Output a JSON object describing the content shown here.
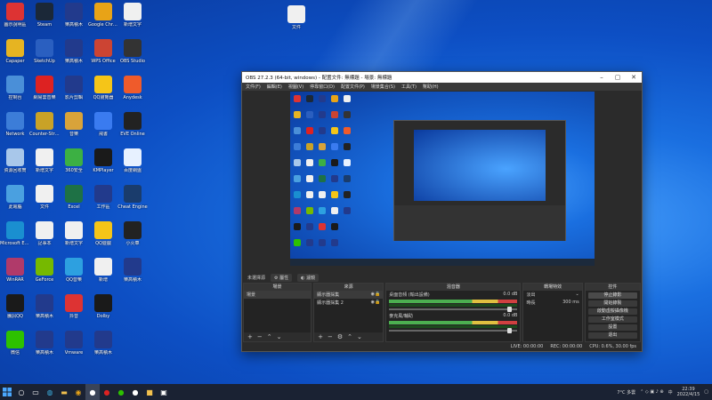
{
  "desktop_icons": [
    {
      "label": "圖示說明區",
      "col": 0,
      "row": 0,
      "color": "#d33"
    },
    {
      "label": "Steam",
      "col": 1,
      "row": 0,
      "color": "#1b2838"
    },
    {
      "label": "樂高積木",
      "col": 2,
      "row": 0,
      "color": "#223a8c"
    },
    {
      "label": "Google Chrome",
      "col": 3,
      "row": 0,
      "color": "#e8a317"
    },
    {
      "label": "新增文字",
      "col": 4,
      "row": 0,
      "color": "#f0f0f0"
    },
    {
      "label": "Capaper",
      "col": 0,
      "row": 1,
      "color": "#e6b422"
    },
    {
      "label": "SketchUp",
      "col": 1,
      "row": 1,
      "color": "#2a5fc0"
    },
    {
      "label": "樂高積木",
      "col": 2,
      "row": 1,
      "color": "#223a8c"
    },
    {
      "label": "WPS Office",
      "col": 3,
      "row": 1,
      "color": "#c43"
    },
    {
      "label": "OBS Studio",
      "col": 4,
      "row": 1,
      "color": "#333"
    },
    {
      "label": "控制台",
      "col": 0,
      "row": 2,
      "color": "#4a8fd8"
    },
    {
      "label": "網易雲音樂",
      "col": 1,
      "row": 2,
      "color": "#d22"
    },
    {
      "label": "影片剪輯",
      "col": 2,
      "row": 2,
      "color": "#223a8c"
    },
    {
      "label": "QQ瀏覽器",
      "col": 3,
      "row": 2,
      "color": "#f5c518"
    },
    {
      "label": "Anydesk",
      "col": 4,
      "row": 2,
      "color": "#ef5b2b"
    },
    {
      "label": "Network",
      "col": 0,
      "row": 3,
      "color": "#3c7dd8"
    },
    {
      "label": "Counter-Strike",
      "col": 1,
      "row": 3,
      "color": "#c9a227"
    },
    {
      "label": "音樂",
      "col": 2,
      "row": 3,
      "color": "#d8a33a"
    },
    {
      "label": "飛書",
      "col": 3,
      "row": 3,
      "color": "#3a7bf0"
    },
    {
      "label": "EVE Online",
      "col": 4,
      "row": 3,
      "color": "#222"
    },
    {
      "label": "资源回收筒",
      "col": 0,
      "row": 4,
      "color": "#a8c7ea"
    },
    {
      "label": "新增文字",
      "col": 1,
      "row": 4,
      "color": "#f0f0f0"
    },
    {
      "label": "360安全",
      "col": 2,
      "row": 4,
      "color": "#3cb043"
    },
    {
      "label": "KMPlayer",
      "col": 3,
      "row": 4,
      "color": "#1a1a1a"
    },
    {
      "label": "百度網盤",
      "col": 4,
      "row": 4,
      "color": "#e7f1ff"
    },
    {
      "label": "此電腦",
      "col": 0,
      "row": 5,
      "color": "#4aa0e0"
    },
    {
      "label": "文件",
      "col": 1,
      "row": 5,
      "color": "#f0f0f0"
    },
    {
      "label": "Excel",
      "col": 2,
      "row": 5,
      "color": "#1e7145"
    },
    {
      "label": "工作區",
      "col": 3,
      "row": 5,
      "color": "#223a8c"
    },
    {
      "label": "Cheat Engine",
      "col": 4,
      "row": 5,
      "color": "#1a3c6c"
    },
    {
      "label": "Microsoft Edge",
      "col": 0,
      "row": 6,
      "color": "#1a8fd0"
    },
    {
      "label": "記事本",
      "col": 1,
      "row": 6,
      "color": "#f0f0f0"
    },
    {
      "label": "新增文字",
      "col": 2,
      "row": 6,
      "color": "#f0f0f0"
    },
    {
      "label": "QQ遊戲",
      "col": 3,
      "row": 6,
      "color": "#f5c518"
    },
    {
      "label": "小火車",
      "col": 4,
      "row": 6,
      "color": "#222"
    },
    {
      "label": "WinRAR",
      "col": 0,
      "row": 7,
      "color": "#b03a6a"
    },
    {
      "label": "GeForce",
      "col": 1,
      "row": 7,
      "color": "#76b900"
    },
    {
      "label": "QQ音樂",
      "col": 2,
      "row": 7,
      "color": "#2da0e0"
    },
    {
      "label": "新增",
      "col": 3,
      "row": 7,
      "color": "#f0f0f0"
    },
    {
      "label": "樂高積木",
      "col": 4,
      "row": 7,
      "color": "#223a8c"
    },
    {
      "label": "騰訊QQ",
      "col": 0,
      "row": 8,
      "color": "#1a1a1a"
    },
    {
      "label": "樂高積木",
      "col": 1,
      "row": 8,
      "color": "#223a8c"
    },
    {
      "label": "抖音",
      "col": 2,
      "row": 8,
      "color": "#d33"
    },
    {
      "label": "Dolby",
      "col": 3,
      "row": 8,
      "color": "#1a1a1a"
    },
    {
      "label": "微信",
      "col": 0,
      "row": 9,
      "color": "#2dc100"
    },
    {
      "label": "樂高積木",
      "col": 1,
      "row": 9,
      "color": "#223a8c"
    },
    {
      "label": "Vmware",
      "col": 2,
      "row": 9,
      "color": "#223a8c"
    },
    {
      "label": "樂高積木",
      "col": 3,
      "row": 9,
      "color": "#223a8c"
    }
  ],
  "top_file": {
    "label": "文件"
  },
  "obs": {
    "title": "OBS 27.2.3 (64-bit, windows) - 配置文件: 無標題 - 場景: 無標題",
    "menu": [
      "文件(F)",
      "編輯(E)",
      "視圖(V)",
      "停靠窗口(D)",
      "配置文件(P)",
      "場景集合(S)",
      "工具(T)",
      "幫助(H)"
    ],
    "tool_label": "未選擇源",
    "tool_buttons": [
      "屬性",
      "濾鏡"
    ],
    "panels": {
      "scenes": {
        "title": "場景",
        "items": [
          "場景"
        ]
      },
      "sources": {
        "title": "來源",
        "items": [
          "顯示器採集",
          "顯示器採集 2"
        ]
      },
      "mixer": {
        "title": "混音器",
        "tracks": [
          {
            "name": "桌面音頻 (輸出設備)",
            "db": "0.0 dB"
          },
          {
            "name": "麥克風/輔助",
            "db": "0.0 dB"
          }
        ]
      },
      "transitions": {
        "title": "轉場特效",
        "type": "淡出",
        "duration_label": "時長",
        "duration": "300 ms"
      },
      "controls": {
        "title": "控件",
        "buttons": [
          "停止錄影",
          "開始錄製",
          "啟動虛擬攝像機",
          "工作室模式",
          "設置",
          "退出"
        ]
      }
    },
    "status": {
      "live": "LIVE: 00:00:00",
      "rec": "REC: 00:00:00",
      "cpu": "CPU: 0.6%, 30.00 fps"
    }
  },
  "taskbar": {
    "apps": [
      "start",
      "search",
      "taskview",
      "edge",
      "explorer",
      "chrome",
      "obs",
      "netease",
      "wechat",
      "qq",
      "folder",
      "terminal"
    ],
    "tray": {
      "weather": "7°C 多雲",
      "ime": "中",
      "time": "22:39",
      "date": "2022/4/15"
    }
  }
}
